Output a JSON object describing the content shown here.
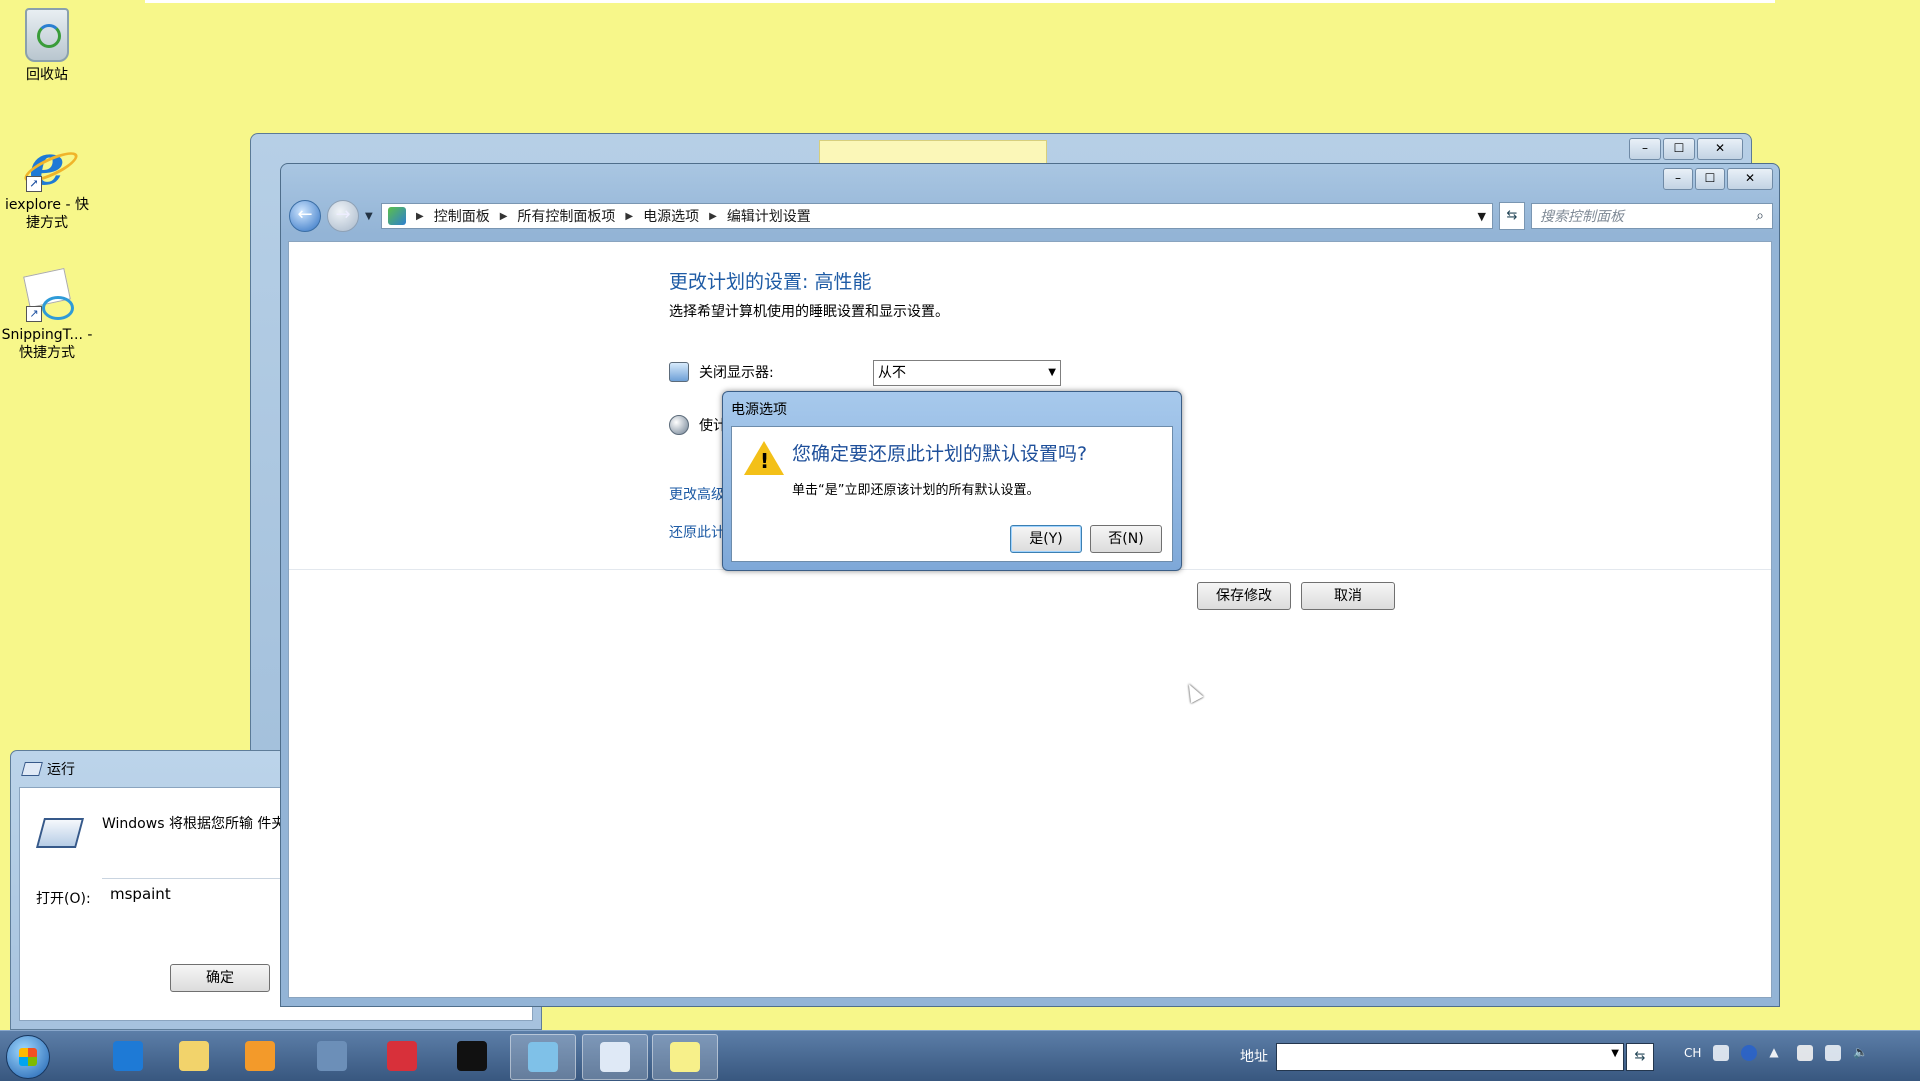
{
  "desktop": {
    "icons": [
      {
        "label": "回收站",
        "icon": "recycle-bin-icon"
      },
      {
        "label": "iexplore - 快捷方式",
        "icon": "internet-explorer-icon"
      },
      {
        "label": "SnippingT... - 快捷方式",
        "icon": "snipping-tool-icon"
      }
    ]
  },
  "control_panel": {
    "address": {
      "crumbs": [
        "控制面板",
        "所有控制面板项",
        "电源选项",
        "编辑计划设置"
      ],
      "search_placeholder": "搜索控制面板"
    },
    "title": "更改计划的设置: 高性能",
    "subtitle": "选择希望计算机使用的睡眠设置和显示设置。",
    "settings": [
      {
        "label": "关闭显示器:",
        "value": "从不"
      },
      {
        "label": "使计"
      }
    ],
    "links": [
      "更改高级",
      "还原此计"
    ],
    "buttons": {
      "save": "保存修改",
      "cancel": "取消"
    }
  },
  "run_dialog": {
    "title": "运行",
    "description": "Windows 将根据您所输 件夹、文档或 Internet",
    "open_label": "打开(O):",
    "input_value": "mspaint",
    "ok": "确定"
  },
  "confirm_dialog": {
    "title": "电源选项",
    "question": "您确定要还原此计划的默认设置吗?",
    "description": "单击“是”立即还原该计划的所有默认设置。",
    "yes": "是(Y)",
    "no": "否(N)"
  },
  "taskbar": {
    "address_label": "地址",
    "tray": {
      "lang": "CH"
    },
    "items": [
      {
        "icon": "internet-explorer-icon",
        "color": "#1e7ad6"
      },
      {
        "icon": "folder-icon",
        "color": "#f2d36b"
      },
      {
        "icon": "media-player-icon",
        "color": "#f39a2a"
      },
      {
        "icon": "network-icon",
        "color": "#6c8fb8"
      },
      {
        "icon": "toolbox-icon",
        "color": "#d8303a"
      },
      {
        "icon": "command-prompt-icon",
        "color": "#111111"
      },
      {
        "icon": "control-panel-icon",
        "color": "#7fc1e8"
      },
      {
        "icon": "run-icon",
        "color": "#dfe9f6"
      },
      {
        "icon": "sticky-notes-icon",
        "color": "#f7f08a"
      }
    ]
  }
}
